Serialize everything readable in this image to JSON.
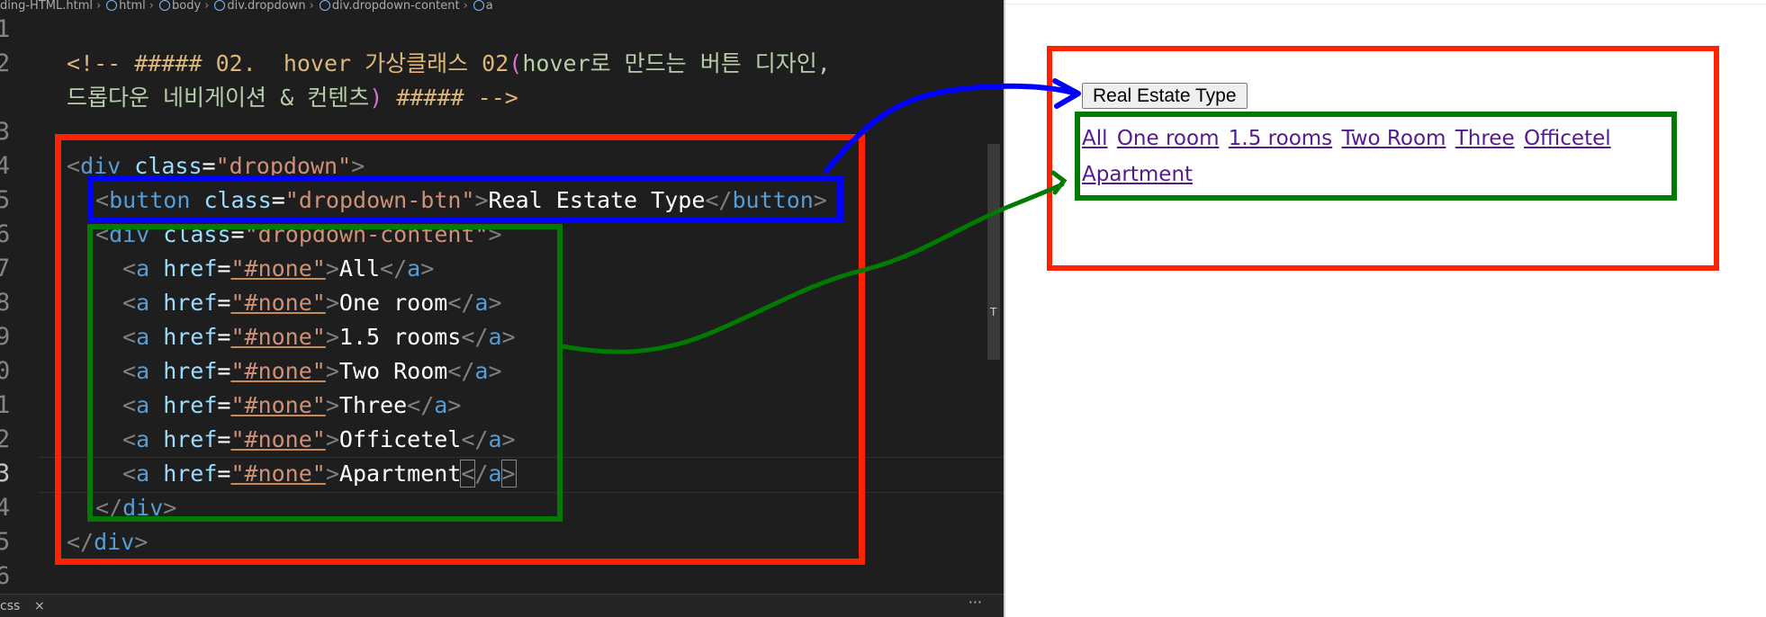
{
  "breadcrumb": [
    "ding-HTML.html",
    "html",
    "body",
    "div.dropdown",
    "div.dropdown-content",
    "a"
  ],
  "line_numbers": [
    "1",
    "2",
    "",
    "3",
    "4",
    "5",
    "6",
    "7",
    "8",
    "9",
    "0",
    "1",
    "2",
    "3",
    "4",
    "5",
    "6"
  ],
  "code": {
    "comment_open": "<!-- ##### 02.  hover 가상클래스 02",
    "paren_open": "(",
    "comment_mid1": "hover로 만드는 버튼 디자인,",
    "comment_mid2": "드롭다운 네비게이션 & 컨텐츠",
    "paren_close": ")",
    "comment_close": " ##### -->",
    "div_open_tag": "div",
    "class_attr": "class",
    "dropdown_class": "\"dropdown\"",
    "button_tag": "button",
    "dropdown_btn_class": "\"dropdown-btn\"",
    "button_text": "Real Estate Type",
    "dropdown_content_class": "\"dropdown-content\"",
    "a_tag": "a",
    "href_attr": "href",
    "href_value": "\"#none\"",
    "link_texts": [
      "All",
      "One room",
      "1.5 rooms",
      "Two Room",
      "Three",
      "Officetel",
      "Apartment"
    ]
  },
  "bottom_panel": {
    "tab_label": "css",
    "close_glyph": "×",
    "more_glyph": "···"
  },
  "preview": {
    "button_label": "Real Estate Type",
    "links": [
      "All",
      "One room",
      "1.5 rooms",
      "Two Room",
      "Three",
      "Officetel",
      "Apartment"
    ]
  },
  "colors": {
    "editor_bg": "#1e1e1e",
    "annotation_red": "#ff2200",
    "annotation_blue": "#0000ff",
    "annotation_green": "#007a00",
    "visited_link": "#551a8b"
  }
}
